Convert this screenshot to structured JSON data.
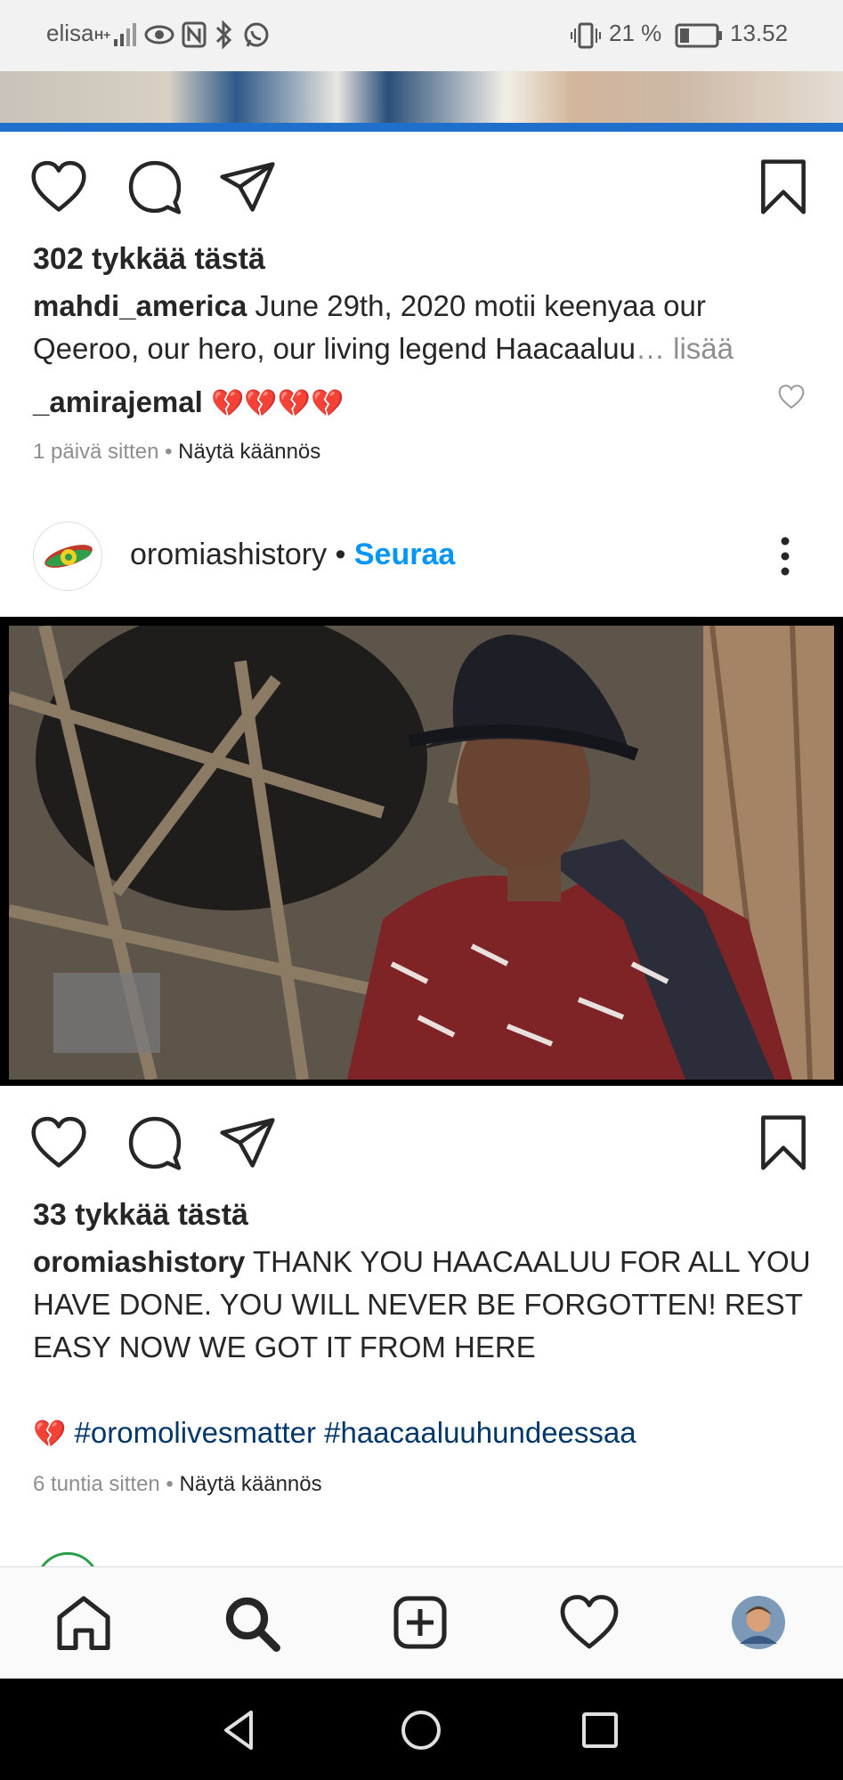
{
  "status_bar": {
    "carrier": "elisa",
    "network": "H+",
    "battery": "21 %",
    "time": "13.52"
  },
  "post1": {
    "likes": "302 tykkää tästä",
    "caption_user": "mahdi_america",
    "caption_text": "June 29th, 2020 motii keenyaa our Qeeroo, our hero, our living legend Haacaaluu",
    "more": "… lisää",
    "comment_user": "_amirajemal",
    "comment_emojis": "💔💔💔💔",
    "time": "1 päivä sitten",
    "separator": " • ",
    "translate": "Näytä käännös"
  },
  "post2": {
    "username": "oromiashistory",
    "dot": " • ",
    "follow": "Seuraa",
    "likes": "33 tykkää tästä",
    "caption_user": "oromiashistory",
    "caption_text": "THANK YOU HAACAALUU FOR ALL YOU HAVE DONE. YOU WILL NEVER BE FORGOTTEN! REST EASY NOW WE GOT IT FROM HERE",
    "emoji": "💔",
    "hashtags": "#oromolivesmatter #haacaaluuhundeessaa",
    "time": "6 tuntia sitten",
    "separator": " • ",
    "translate": "Näytä käännös"
  },
  "icons": {
    "like": "heart-icon",
    "comment": "comment-icon",
    "share": "send-icon",
    "save": "bookmark-icon",
    "more": "more-vertical-icon",
    "home": "home-icon",
    "search": "search-icon",
    "add": "add-post-icon",
    "activity": "heart-icon",
    "profile": "avatar"
  },
  "colors": {
    "link_blue": "#0095f6",
    "hashtag": "#00376b",
    "muted": "#8e8e8e",
    "text": "#262626"
  }
}
